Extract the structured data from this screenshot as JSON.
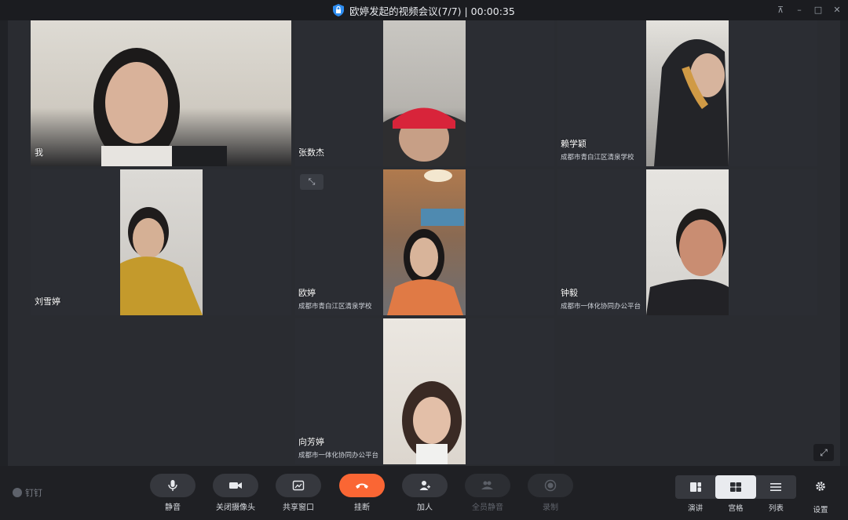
{
  "window": {
    "title": "欧婷发起的视频会议(7/7) | 00:00:35"
  },
  "participants": [
    {
      "name": "我",
      "org": "",
      "photo_bg": "#c9c3b8"
    },
    {
      "name": "张数杰",
      "org": "",
      "photo_bg": "#b9b7b2"
    },
    {
      "name": "赖学颖",
      "org": "成都市青白江区清泉学校",
      "photo_bg": "#3a3b3f"
    },
    {
      "name": "刘雪婷",
      "org": "",
      "photo_bg": "#d2d0cc"
    },
    {
      "name": "欧婷",
      "org": "成都市青白江区清泉学校",
      "photo_bg": "#a07a55"
    },
    {
      "name": "钟毅",
      "org": "成都市一体化协同办公平台",
      "photo_bg": "#d8d6d2"
    },
    {
      "name": "向芳婷",
      "org": "成都市一体化协同办公平台",
      "photo_bg": "#e2ded8"
    }
  ],
  "toolbar": {
    "brand": "钉钉",
    "mute": "静音",
    "camera_off": "关闭摄像头",
    "share_window": "共享窗口",
    "hang_up": "挂断",
    "add_person": "加人",
    "mute_all": "全员静音",
    "record": "录制",
    "layout_speaker": "演讲",
    "layout_grid": "宫格",
    "layout_list": "列表",
    "settings": "设置"
  },
  "colors": {
    "hangup": "#fa6634",
    "background": "#202226",
    "tile": "#2b2d33"
  }
}
